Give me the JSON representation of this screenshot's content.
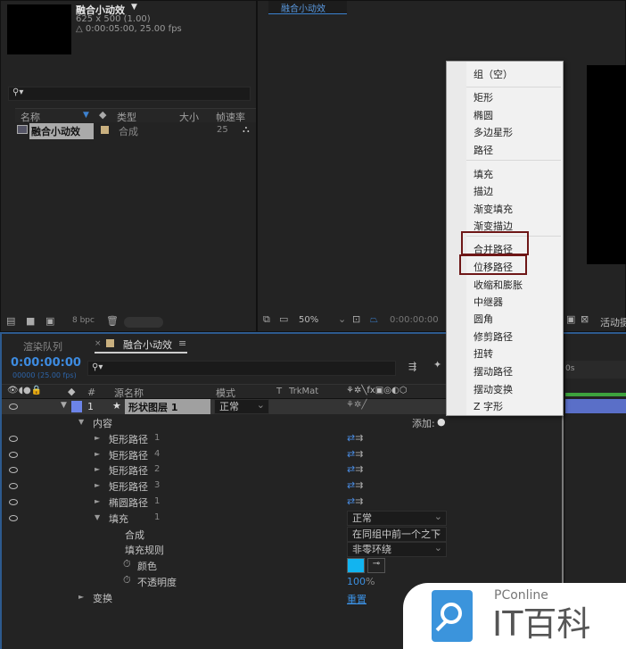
{
  "project": {
    "comp_name": "融合小动效",
    "dimensions": "625 x 500 (1.00)",
    "duration": "△ 0:00:05:00, 25.00 fps",
    "columns": [
      "名称",
      "类型",
      "大小",
      "帧速率"
    ],
    "items": [
      {
        "name": "融合小动效",
        "type": "合成",
        "size": "",
        "fps": "25"
      }
    ],
    "bpc": "8 bpc"
  },
  "viewer": {
    "tab": "融合小动效",
    "zoom": "50%",
    "timecode": "0:00:00:00",
    "active_camera": "活动摄"
  },
  "timeline": {
    "tabs": [
      "渲染队列",
      "融合小动效"
    ],
    "timecode": "0:00:00:00",
    "timecode_sub": "00000 (25.00 fps)",
    "ruler_label": "0s",
    "columns": {
      "num": "#",
      "source": "源名称",
      "mode": "模式",
      "t": "T",
      "trkmat": "TrkMat"
    },
    "layer": {
      "num": "1",
      "name": "形状图层 1",
      "mode": "正常"
    },
    "add_label": "添加:",
    "rows": [
      {
        "label": "内容",
        "level": 1,
        "expanded": true,
        "eye": false
      },
      {
        "label": "矩形路径",
        "suffix": "1",
        "level": 2,
        "eye": true
      },
      {
        "label": "矩形路径",
        "suffix": "4",
        "level": 2,
        "eye": true
      },
      {
        "label": "矩形路径",
        "suffix": "2",
        "level": 2,
        "eye": true
      },
      {
        "label": "矩形路径",
        "suffix": "3",
        "level": 2,
        "eye": true
      },
      {
        "label": "椭圆路径",
        "suffix": "1",
        "level": 2,
        "eye": true
      },
      {
        "label": "填充",
        "suffix": "1",
        "level": 2,
        "eye": true,
        "expanded": true,
        "value": "正常"
      },
      {
        "label": "合成",
        "level": 3,
        "value": "在同组中前一个之下"
      },
      {
        "label": "填充规则",
        "level": 3,
        "value": "非零环绕"
      },
      {
        "label": "颜色",
        "level": 3,
        "stopwatch": true
      },
      {
        "label": "不透明度",
        "level": 3,
        "stopwatch": true,
        "value": "100",
        "unit": "%"
      },
      {
        "label": "变换",
        "level": 1,
        "value": "重置"
      }
    ],
    "fill_color": "#12b4f0"
  },
  "menu": {
    "items": [
      "组（空）",
      "矩形",
      "椭圆",
      "多边星形",
      "路径",
      "填充",
      "描边",
      "渐变填充",
      "渐变描边",
      "合并路径",
      "位移路径",
      "收缩和膨胀",
      "中继器",
      "圆角",
      "修剪路径",
      "扭转",
      "摆动路径",
      "摆动变换",
      "Z 字形"
    ],
    "highlighted": [
      "合并路径",
      "位移路径"
    ]
  },
  "watermark": {
    "brand": "PConline",
    "name": "IT百科"
  }
}
